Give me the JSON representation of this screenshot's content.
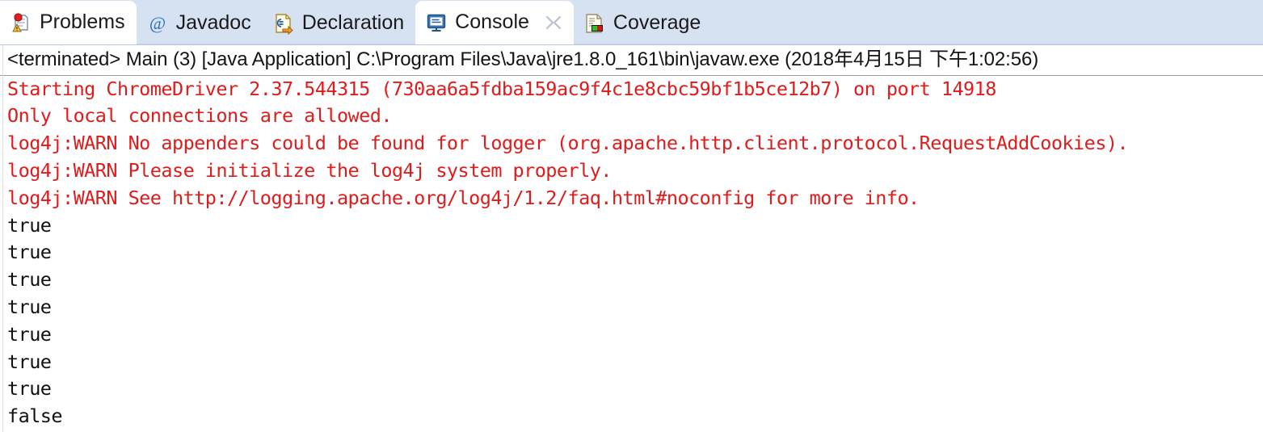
{
  "window": {
    "app": "Eclipse IDE",
    "view": "Console"
  },
  "tabs": [
    {
      "id": "problems",
      "label": "Problems",
      "icon": "problems-icon",
      "active": true,
      "closable": false
    },
    {
      "id": "javadoc",
      "label": "Javadoc",
      "icon": "at-sign-icon",
      "active": false,
      "closable": false
    },
    {
      "id": "declaration",
      "label": "Declaration",
      "icon": "declaration-icon",
      "active": false,
      "closable": false
    },
    {
      "id": "console",
      "label": "Console",
      "icon": "console-icon",
      "active": true,
      "closable": true
    },
    {
      "id": "coverage",
      "label": "Coverage",
      "icon": "coverage-icon",
      "active": false,
      "closable": false
    }
  ],
  "console": {
    "terminated_line": "<terminated> Main (3) [Java Application] C:\\Program Files\\Java\\jre1.8.0_161\\bin\\javaw.exe (2018年4月15日 下午1:02:56)",
    "colors": {
      "error_text": "#e01b1b",
      "standard_text": "#101010",
      "tabbar_background": "#d6e2f2",
      "active_tab_background": "#ffffff",
      "console_background": "#ffffff"
    },
    "output": [
      {
        "stream": "err",
        "text": "Starting ChromeDriver 2.37.544315 (730aa6a5fdba159ac9f4c1e8cbc59bf1b5ce12b7) on port 14918"
      },
      {
        "stream": "err",
        "text": "Only local connections are allowed."
      },
      {
        "stream": "err",
        "text": "log4j:WARN No appenders could be found for logger (org.apache.http.client.protocol.RequestAddCookies)."
      },
      {
        "stream": "err",
        "text": "log4j:WARN Please initialize the log4j system properly."
      },
      {
        "stream": "err",
        "text": "log4j:WARN See http://logging.apache.org/log4j/1.2/faq.html#noconfig for more info."
      },
      {
        "stream": "out",
        "text": "true"
      },
      {
        "stream": "out",
        "text": "true"
      },
      {
        "stream": "out",
        "text": "true"
      },
      {
        "stream": "out",
        "text": "true"
      },
      {
        "stream": "out",
        "text": "true"
      },
      {
        "stream": "out",
        "text": "true"
      },
      {
        "stream": "out",
        "text": "true"
      },
      {
        "stream": "out",
        "text": "false"
      }
    ]
  }
}
